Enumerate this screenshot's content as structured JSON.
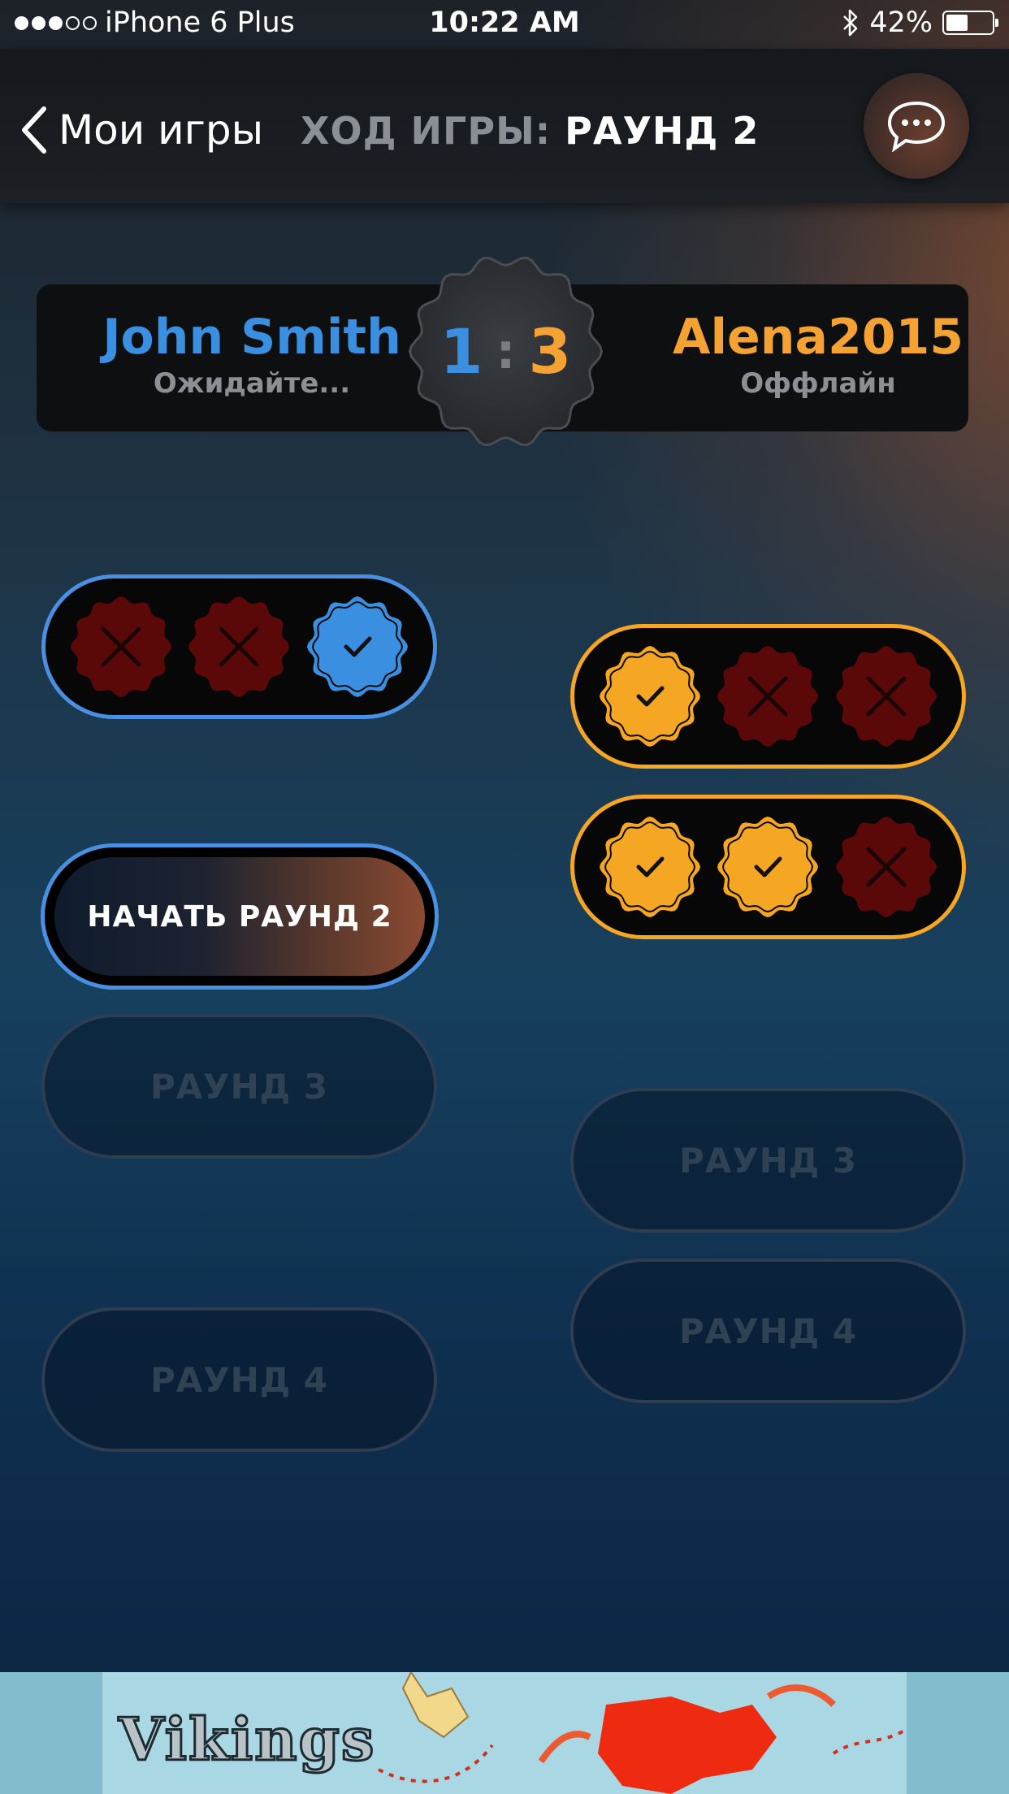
{
  "status_bar": {
    "carrier": "iPhone 6 Plus",
    "signal_dots_filled": 3,
    "signal_dots_total": 5,
    "time": "10:22 AM",
    "battery": "42%",
    "bluetooth": "bluetooth-icon"
  },
  "nav": {
    "back_label": "Мои игры",
    "title_label": "ХОД ИГРЫ:",
    "title_value": "РАУНД 2",
    "chat_icon": "chat-bubble-icon"
  },
  "players": {
    "left": {
      "name": "John Smith",
      "status": "Ожидайте...",
      "score": "1"
    },
    "right": {
      "name": "Alena2015",
      "status": "Оффлайн",
      "score": "3"
    },
    "separator": ":"
  },
  "colors": {
    "player_left": "#3a8fe0",
    "player_right": "#f3a233",
    "wrong": "#5a0808",
    "correct_blue": "#3a8fe0",
    "correct_orange": "#f5a623"
  },
  "rounds": {
    "left": {
      "round1_results": [
        "wrong",
        "wrong",
        "correct"
      ],
      "start_button": "НАЧАТЬ РАУНД 2",
      "round3": "РАУНД 3",
      "round4": "РАУНД 4"
    },
    "right": {
      "round1_results": [
        "correct",
        "wrong",
        "wrong"
      ],
      "round2_results": [
        "correct",
        "correct",
        "wrong"
      ],
      "round3": "РАУНД 3",
      "round4": "РАУНД 4"
    }
  },
  "ad": {
    "text": "Vikings"
  }
}
